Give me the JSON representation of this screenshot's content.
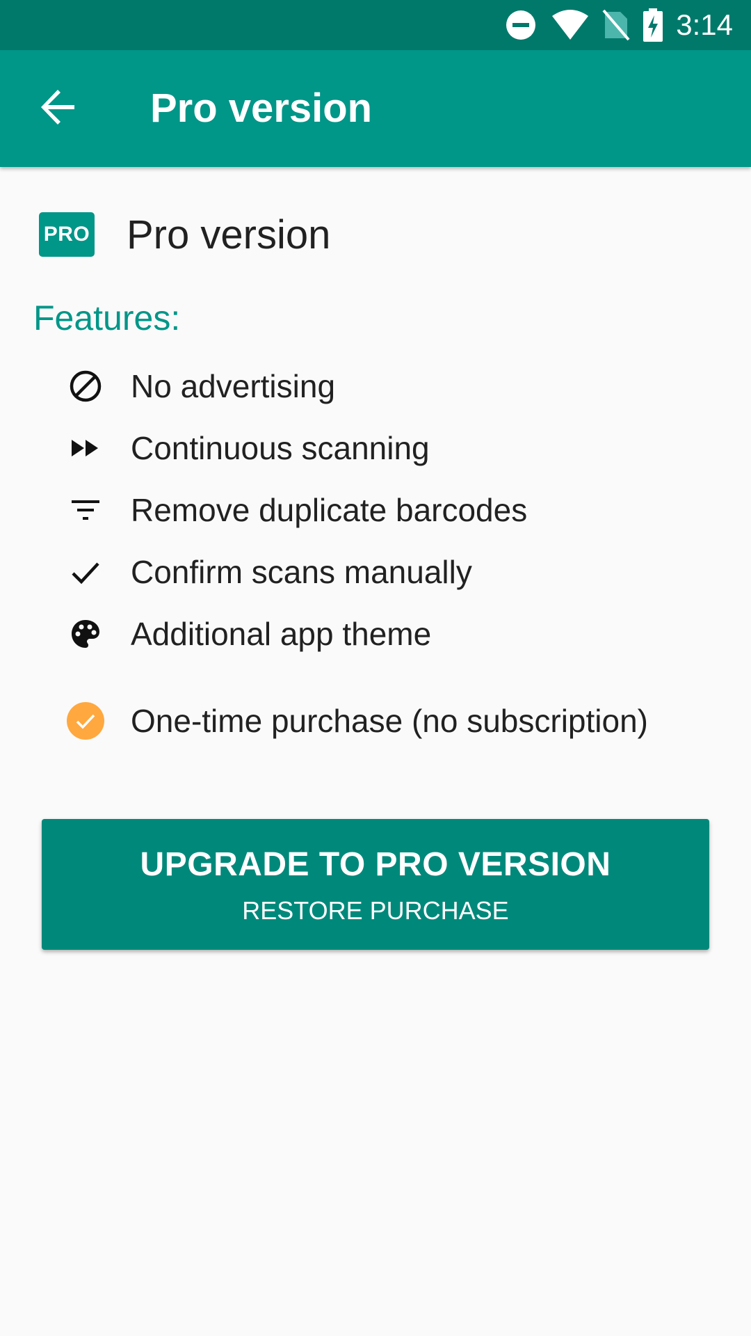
{
  "status_bar": {
    "time": "3:14",
    "icons": [
      "do-not-disturb-icon",
      "wifi-icon",
      "no-sim-icon",
      "battery-charging-icon"
    ]
  },
  "app_bar": {
    "back_icon": "arrow-back-icon",
    "title": "Pro version"
  },
  "header": {
    "badge": "PRO",
    "title": "Pro version"
  },
  "features_label": "Features:",
  "features": [
    {
      "icon": "block-icon",
      "label": "No advertising"
    },
    {
      "icon": "fast-forward-icon",
      "label": "Continuous scanning"
    },
    {
      "icon": "filter-list-icon",
      "label": "Remove duplicate barcodes"
    },
    {
      "icon": "check-icon",
      "label": "Confirm scans manually"
    },
    {
      "icon": "palette-icon",
      "label": "Additional app theme"
    }
  ],
  "one_time": {
    "icon": "check-circle-icon",
    "label": "One-time purchase (no subscription)"
  },
  "upgrade_button": {
    "main_label": "UPGRADE TO PRO VERSION",
    "sub_label": "RESTORE PURCHASE"
  },
  "colors": {
    "primary": "#009688",
    "primary_dark": "#00796b",
    "accent": "#ffa83f"
  }
}
